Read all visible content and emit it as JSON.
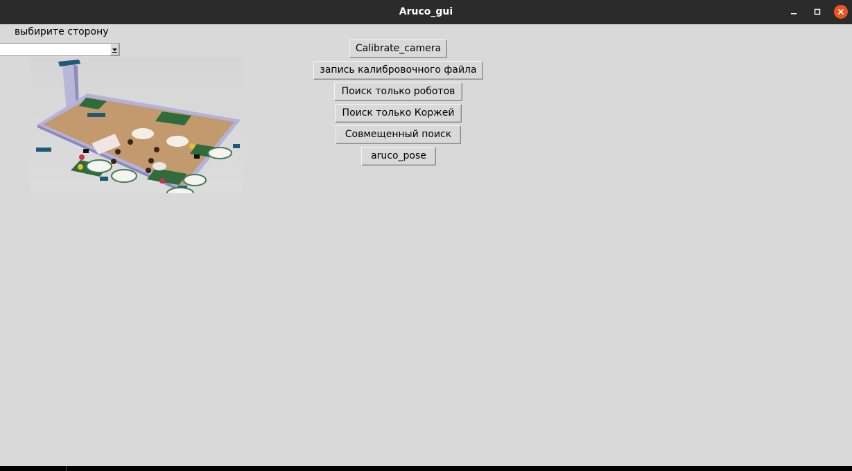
{
  "window": {
    "title": "Aruco_gui",
    "controls": {
      "minimize_icon": "minimize-icon",
      "maximize_icon": "maximize-icon",
      "close_icon": "close-icon"
    }
  },
  "side_selector": {
    "label": "выбирите сторону",
    "value": ""
  },
  "buttons": {
    "calibrate": "Calibrate_camera",
    "write_calibration": "запись калибровочного файла",
    "search_robots": "Поиск только роботов",
    "search_cakes": "Поиск только Коржей",
    "combined_search": "Совмещенный поиск",
    "aruco_pose": "aruco_pose"
  },
  "colors": {
    "window_bg": "#d9d9d9",
    "titlebar_bg": "#2b2b2b",
    "close_button": "#e95420"
  }
}
